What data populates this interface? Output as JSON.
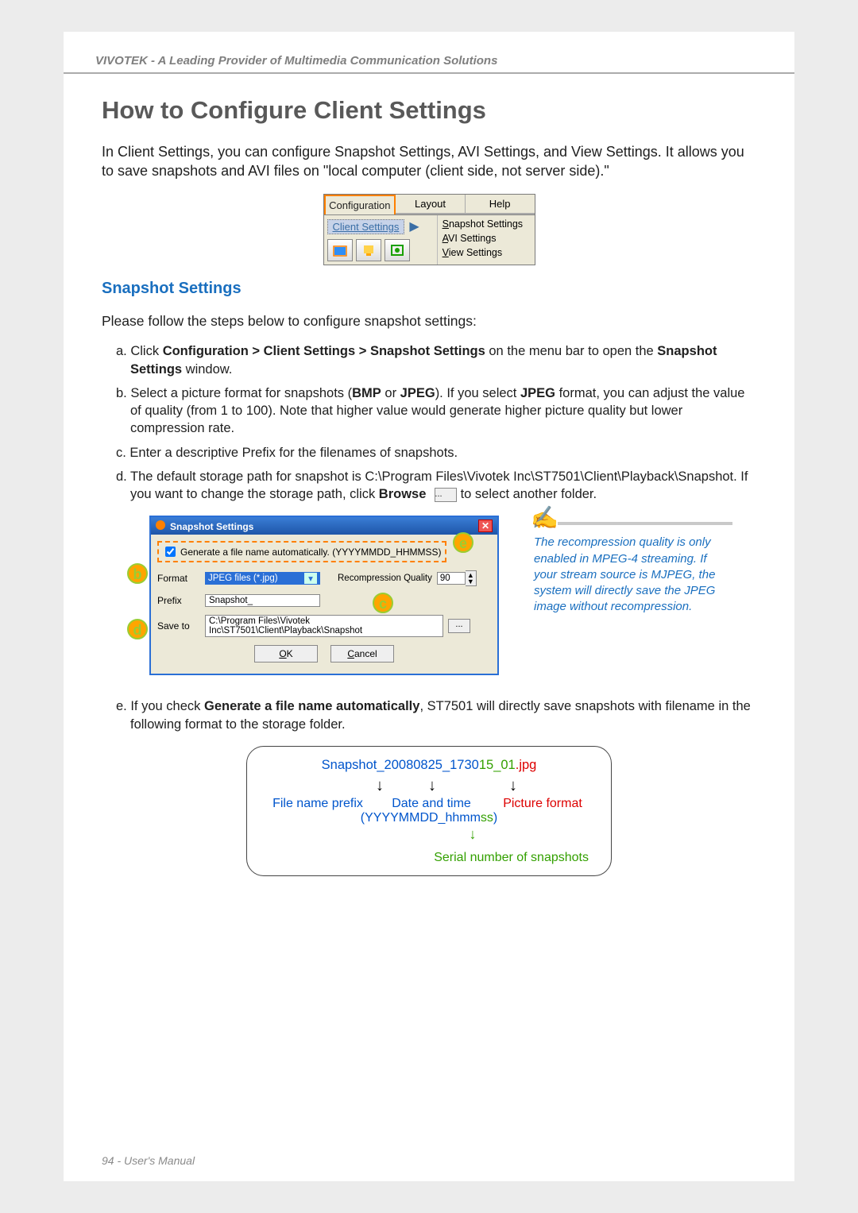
{
  "header": {
    "brand_line": "VIVOTEK - A Leading Provider of Multimedia Communication Solutions"
  },
  "title": "How to Configure Client Settings",
  "intro": "In Client Settings, you can configure Snapshot Settings, AVI Settings, and View Settings. It allows you to save snapshots and AVI files on \"local computer (client side, not server side).\"",
  "tabs": {
    "configuration": "Configuration",
    "layout": "Layout",
    "help": "Help",
    "client_settings": "Client Settings",
    "menu": {
      "snapshot": "Snapshot Settings",
      "snapshot_u": "S",
      "avi": "AVI Settings",
      "avi_u": "A",
      "view": "View Settings",
      "view_u": "V"
    }
  },
  "section1": {
    "heading": "Snapshot Settings",
    "intro": "Please follow the steps below to configure snapshot settings:",
    "steps": {
      "a_pre": "a. Click ",
      "a_bold": "Configuration > Client Settings > Snapshot Settings",
      "a_mid": " on the menu bar to open the ",
      "a_bold2": "Snapshot Settings",
      "a_end": " window.",
      "b_pre": "b. Select a picture format for snapshots (",
      "b_bmp": "BMP",
      "b_or": " or ",
      "b_jpeg": "JPEG",
      "b_mid": "). If you select ",
      "b_jpeg2": "JPEG",
      "b_end": " format, you can adjust the value of quality (from 1 to 100). Note that higher value would generate higher picture quality but lower compression rate.",
      "c": "c. Enter a descriptive Prefix for the filenames of snapshots.",
      "d_pre": "d. The default storage path for snapshot is C:\\Program Files\\Vivotek Inc\\ST7501\\Client\\Playback\\Snapshot. If you want to change the storage path, click ",
      "d_bold": "Browse",
      "d_end": " to select another folder."
    }
  },
  "markers": {
    "b": "b",
    "c": "c",
    "d": "d",
    "e": "e"
  },
  "dialog": {
    "title": "Snapshot Settings",
    "gen_checkbox": "Generate a file name automatically. (YYYYMMDD_HHMMSS)",
    "format_label": "Format",
    "format_value": "JPEG files (*.jpg)",
    "rq_label": "Recompression Quality",
    "rq_value": "90",
    "prefix_label": "Prefix",
    "prefix_value": "Snapshot_",
    "saveto_label": "Save to",
    "saveto_value": "C:\\Program Files\\Vivotek Inc\\ST7501\\Client\\Playback\\Snapshot",
    "browse": "...",
    "ok": "OK",
    "cancel": "Cancel"
  },
  "tip": "The recompression quality is only enabled in MPEG-4 streaming. If your stream source is MJPEG, the system will directly save the JPEG image without recompression.",
  "step_e": {
    "pre": "e. If you check ",
    "bold": "Generate a file name automatically",
    "end": ", ST7501 will directly save snapshots with filename in the following format to the storage folder."
  },
  "filename_figure": {
    "prefix": "Snapshot_",
    "dt": "20080825_1730",
    "dt_ss_overlap": "15_",
    "serial": "01",
    "dot": ".",
    "ext": "jpg",
    "lbl_prefix": "File name prefix",
    "lbl_dt": "Date and time",
    "lbl_fmt": "Picture format",
    "fmt_pattern_left": "(YYYYMMDD_hhmm",
    "fmt_pattern_ss": "ss",
    "fmt_pattern_right": ")",
    "serial_label": "Serial number of snapshots"
  },
  "footer": "94 - User's Manual"
}
